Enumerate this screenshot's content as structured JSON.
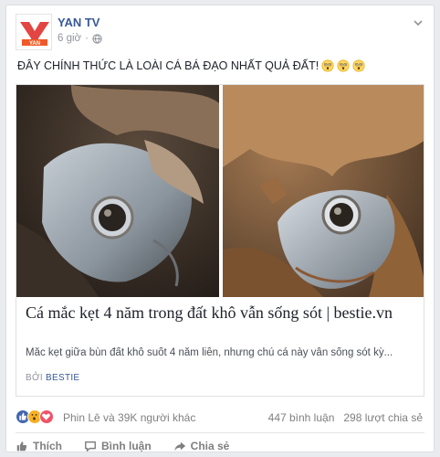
{
  "post": {
    "page_name": "YAN TV",
    "avatar_logo_text": "YAN",
    "time": "6 giờ",
    "separator": "·",
    "text": "ĐÂY CHÍNH THỨC LÀ LOÀI CÁ BÁ ĐẠO NHẤT QUẢ ĐẤT!"
  },
  "link": {
    "title": "Cá mắc kẹt 4 năm trong đất khô vẫn sống sót | bestie.vn",
    "description": "Mắc kẹt giữa bùn đất khô suốt 4 năm liền, nhưng chú cá này vẫn sống sót kỳ...",
    "source_prefix": "BỞI",
    "source_name": "BESTIE"
  },
  "reactions": {
    "names": "Phin Lê và 39K người khác",
    "comments": "447 bình luận",
    "shares": "298 lượt chia sẻ"
  },
  "actions": {
    "like": "Thích",
    "comment": "Bình luận",
    "share": "Chia sẻ"
  },
  "colors": {
    "link_blue": "#365899",
    "like_blue": "#4267b2",
    "love_red": "#f25268",
    "wow_yellow": "#f7b125",
    "logo_red": "#e0312e"
  },
  "icons": {
    "emoji_count": 3,
    "emoji_name": "astonished-face-icon"
  }
}
